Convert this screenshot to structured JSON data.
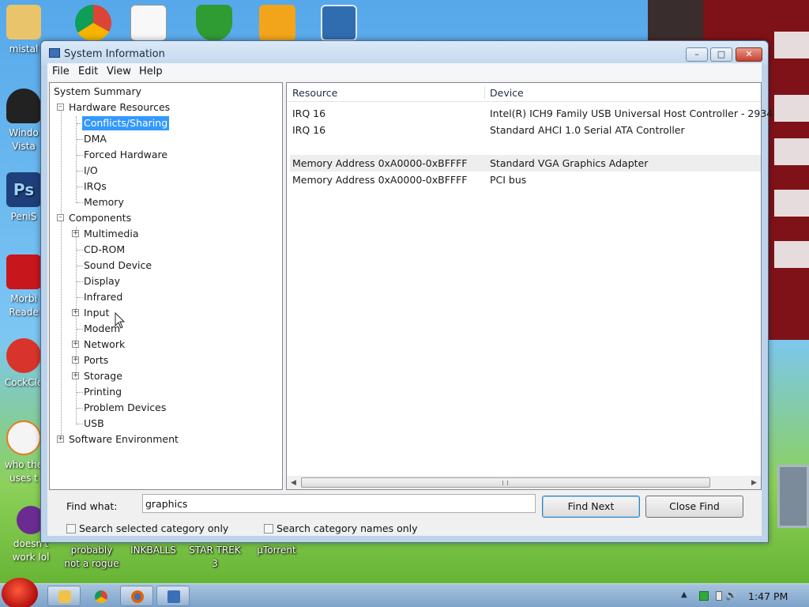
{
  "window": {
    "title": "System Information",
    "buttons": {
      "minimize": "–",
      "maximize": "□",
      "close": "✕"
    }
  },
  "menu": [
    "File",
    "Edit",
    "View",
    "Help"
  ],
  "tree": {
    "root": "System Summary",
    "hardware": {
      "label": "Hardware Resources",
      "children": [
        "Conflicts/Sharing",
        "DMA",
        "Forced Hardware",
        "I/O",
        "IRQs",
        "Memory"
      ],
      "selected": "Conflicts/Sharing"
    },
    "components": {
      "label": "Components",
      "children": [
        {
          "label": "Multimedia",
          "expandable": true
        },
        {
          "label": "CD-ROM",
          "expandable": false
        },
        {
          "label": "Sound Device",
          "expandable": false
        },
        {
          "label": "Display",
          "expandable": false
        },
        {
          "label": "Infrared",
          "expandable": false
        },
        {
          "label": "Input",
          "expandable": true
        },
        {
          "label": "Modem",
          "expandable": false
        },
        {
          "label": "Network",
          "expandable": true
        },
        {
          "label": "Ports",
          "expandable": true
        },
        {
          "label": "Storage",
          "expandable": true
        },
        {
          "label": "Printing",
          "expandable": false
        },
        {
          "label": "Problem Devices",
          "expandable": false
        },
        {
          "label": "USB",
          "expandable": false
        }
      ]
    },
    "software": {
      "label": "Software Environment"
    }
  },
  "list": {
    "columns": [
      "Resource",
      "Device"
    ],
    "rows": [
      {
        "resource": "IRQ 16",
        "device": "Intel(R) ICH9 Family USB Universal Host Controller - 2934",
        "highlight": false
      },
      {
        "resource": "IRQ 16",
        "device": "Standard AHCI 1.0 Serial ATA Controller",
        "highlight": false
      },
      {
        "resource": "",
        "device": "",
        "highlight": false
      },
      {
        "resource": "Memory Address 0xA0000-0xBFFFF",
        "device": "Standard VGA Graphics Adapter",
        "highlight": true
      },
      {
        "resource": "Memory Address 0xA0000-0xBFFFF",
        "device": "PCI bus",
        "highlight": false
      }
    ]
  },
  "find": {
    "label": "Find what:",
    "value": "graphics",
    "find_next": "Find Next",
    "close_find": "Close Find",
    "opt_selected": "Search selected category only",
    "opt_names": "Search category names only"
  },
  "desktop": {
    "top_icons": [
      "chrome-icon",
      "solitaire-icon",
      "security-shield-icon",
      "angry-birds-pig-icon",
      "photo-viewer-icon"
    ],
    "left_labels": [
      "mistal",
      "Windo\nVista",
      "PeniS",
      "Morbi\nReade",
      "CockCle",
      "who the\nuses t",
      "doesn't\nwork lol"
    ],
    "bottom_labels": [
      "probably\nnot a rogue",
      "INKBALLS",
      "STAR TREK\n3",
      "µTorrent"
    ]
  },
  "taskbar": {
    "time": "1:47 PM"
  },
  "colors": {
    "selection": "#3399ff",
    "window_frame": "#bcd3ea",
    "taskbar": "#8fb1d6"
  }
}
